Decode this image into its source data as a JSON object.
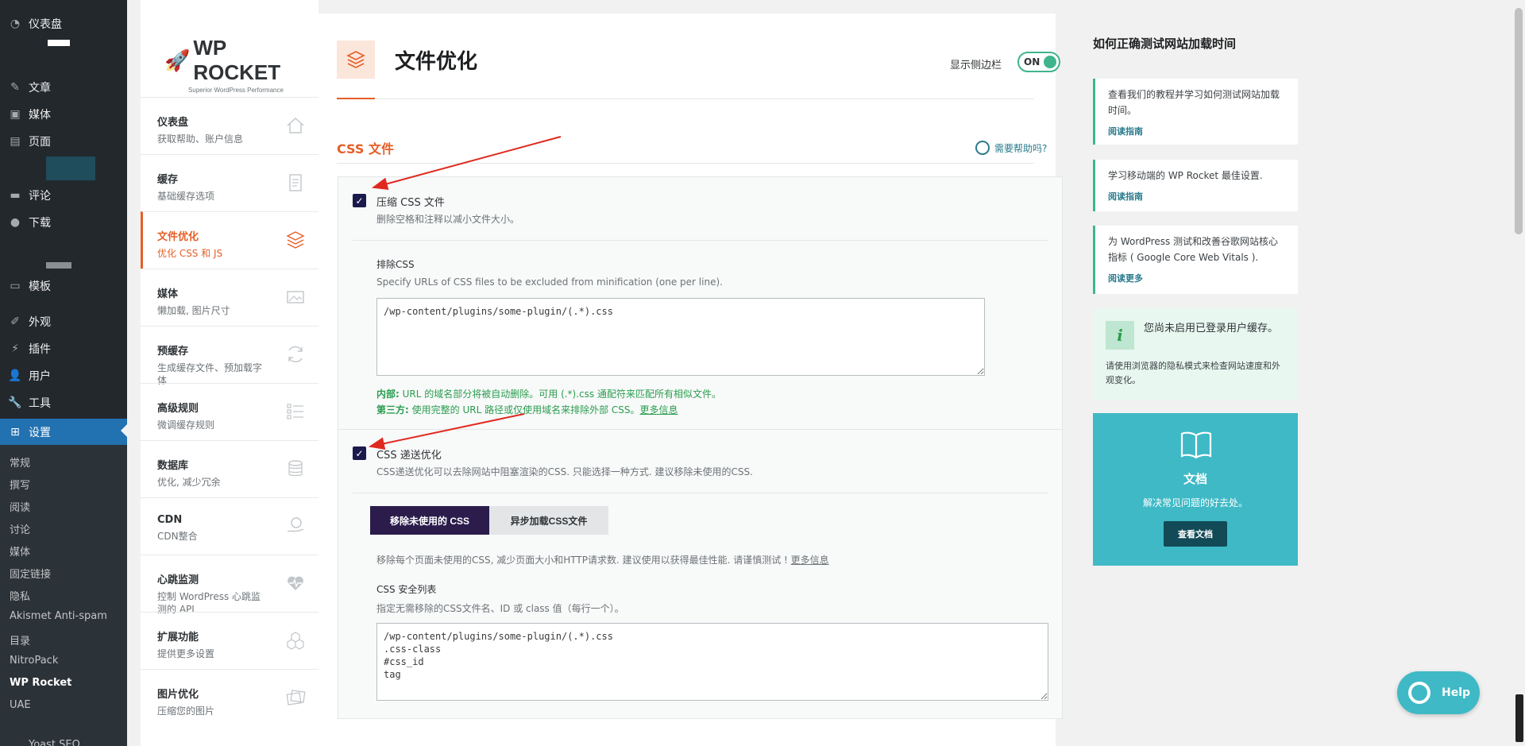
{
  "wp_sidebar": {
    "menu": [
      {
        "label": "仪表盘",
        "icon": "dashboard-icon"
      },
      {
        "label": "文章",
        "icon": "pin-icon"
      },
      {
        "label": "媒体",
        "icon": "media-icon"
      },
      {
        "label": "页面",
        "icon": "page-icon"
      },
      {
        "label": "评论",
        "icon": "comment-icon"
      },
      {
        "label": "下载",
        "icon": "download-icon"
      },
      {
        "label": "模板",
        "icon": "folder-icon"
      },
      {
        "label": "外观",
        "icon": "brush-icon"
      },
      {
        "label": "插件",
        "icon": "plugin-icon"
      },
      {
        "label": "用户",
        "icon": "user-icon"
      },
      {
        "label": "工具",
        "icon": "wrench-icon"
      },
      {
        "label": "设置",
        "icon": "settings-icon"
      }
    ],
    "submenu": [
      "常规",
      "撰写",
      "阅读",
      "讨论",
      "媒体",
      "固定链接",
      "隐私",
      "Akismet Anti-spam",
      "目录",
      "NitroPack",
      "WP Rocket",
      "UAE",
      "Yoast SEO"
    ],
    "current_submenu": "WP Rocket"
  },
  "logo": {
    "brand": "WP ROCKET",
    "tagline": "Superior WordPress Performance"
  },
  "nav": [
    {
      "title": "仪表盘",
      "desc": "获取帮助、账户信息",
      "icon": "home-icon"
    },
    {
      "title": "缓存",
      "desc": "基础缓存选项",
      "icon": "document-icon"
    },
    {
      "title": "文件优化",
      "desc": "优化 CSS 和 JS",
      "icon": "layers-icon"
    },
    {
      "title": "媒体",
      "desc": "懒加载, 图片尺寸",
      "icon": "image-icon"
    },
    {
      "title": "预缓存",
      "desc": "生成缓存文件、预加载字体",
      "icon": "refresh-icon"
    },
    {
      "title": "高级规则",
      "desc": "微调缓存规则",
      "icon": "list-icon"
    },
    {
      "title": "数据库",
      "desc": "优化, 减少冗余",
      "icon": "database-icon"
    },
    {
      "title": "CDN",
      "desc": "CDN整合",
      "icon": "cloud-hand-icon"
    },
    {
      "title": "心跳监测",
      "desc": "控制 WordPress 心跳监测的 API",
      "icon": "heartbeat-icon"
    },
    {
      "title": "扩展功能",
      "desc": "提供更多设置",
      "icon": "cubes-icon"
    },
    {
      "title": "图片优化",
      "desc": "压缩您的图片",
      "icon": "images-icon"
    }
  ],
  "nav_active": 2,
  "page": {
    "title": "文件优化",
    "sidebar_toggle_label": "显示侧边栏",
    "toggle_state": "ON",
    "section": "CSS 文件",
    "help_link": "需要帮助吗?"
  },
  "css": {
    "minify": {
      "label": "压缩 CSS 文件",
      "desc": "删除空格和注释以减小文件大小。",
      "checked": true
    },
    "exclude": {
      "label": "排除CSS",
      "desc": "Specify URLs of CSS files to be excluded from minification (one per line).",
      "value": "/wp-content/plugins/some-plugin/(.*).css",
      "note1_bold": "内部:",
      "note1": " URL 的域名部分将被自动删除。可用 (.*).css 通配符来匹配所有相似文件。",
      "note2_bold": "第三方:",
      "note2": " 使用完整的 URL 路径或仅使用域名来排除外部 CSS。",
      "note2_link": "更多信息"
    },
    "delivery": {
      "label": "CSS 递送优化",
      "desc": "CSS递送优化可以去除网站中阻塞渲染的CSS. 只能选择一种方式. 建议移除未使用的CSS.",
      "checked": true
    },
    "btn_remove": "移除未使用的 CSS",
    "btn_async": "异步加载CSS文件",
    "remove_desc": "移除每个页面未使用的CSS, 减少页面大小和HTTP请求数. 建议使用以获得最佳性能. 请谨慎测试 ! ",
    "remove_link": "更多信息",
    "safelist": {
      "label": "CSS 安全列表",
      "desc": "指定无需移除的CSS文件名、ID 或 class 值（每行一个）。",
      "value": "/wp-content/plugins/some-plugin/(.*).css\n.css-class\n#css_id\ntag"
    }
  },
  "right": {
    "title": "如何正确测试网站加载时间",
    "cards": [
      {
        "text": "查看我们的教程并学习如何测试网站加载时间。",
        "link": "阅读指南"
      },
      {
        "text": "学习移动端的 WP Rocket 最佳设置.",
        "link": "阅读指南"
      },
      {
        "text": "为 WordPress 测试和改善谷歌网站核心指标 ( Google Core Web Vitals ).",
        "link": "阅读更多"
      }
    ],
    "info": {
      "glyph": "i",
      "title": "您尚未启用已登录用户缓存。",
      "desc": "请使用浏览器的隐私模式来检查网站速度和外观变化。"
    },
    "doc": {
      "title": "文档",
      "desc": "解决常见问题的好去处。",
      "button": "查看文档"
    }
  },
  "help_button": "Help",
  "colors": {
    "accent": "#e65e27",
    "teal": "#3fb9c6",
    "green": "#40b48d",
    "wp_blue": "#2271b1",
    "dark_purple": "#2b1c4c"
  }
}
